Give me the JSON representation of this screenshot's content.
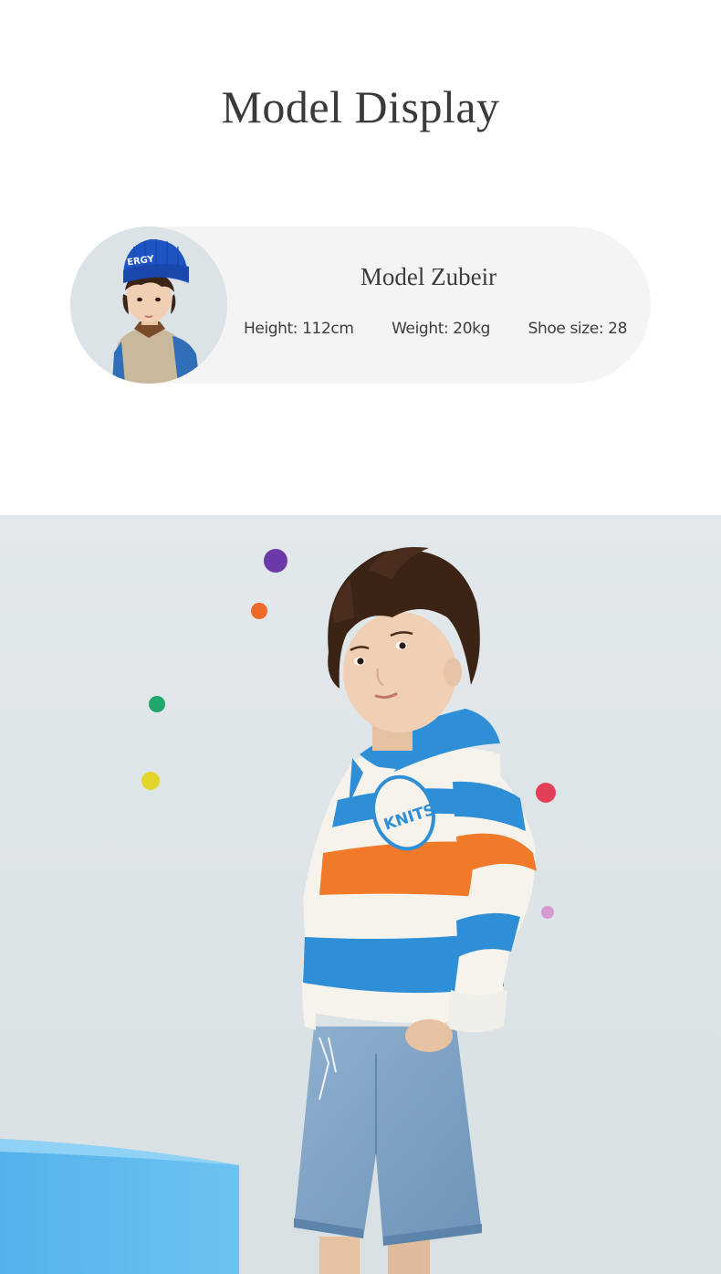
{
  "header": {
    "title": "Model Display"
  },
  "model": {
    "name": "Model Zubeir",
    "height": "Height: 112cm",
    "weight": "Weight: 20kg",
    "shoe_size": "Shoe size: 28",
    "hat_text": "ERGY"
  },
  "hero": {
    "badge_text": "KNITS"
  },
  "colors": {
    "card_background": "#f4f4f4",
    "photo_background": "#dfe5e8",
    "stripe_blue": "#2f8fd6",
    "stripe_orange": "#f07a2a",
    "stripe_cream": "#f6f3ec",
    "denim": "#7fa3c5",
    "pedestal": "#5bb8ec"
  }
}
